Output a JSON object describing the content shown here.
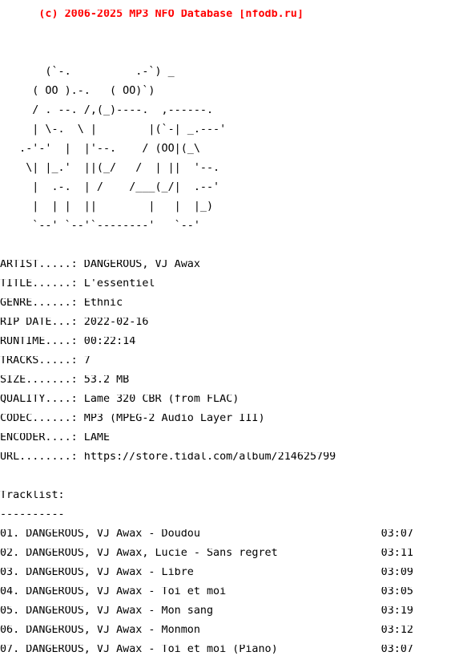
{
  "colors": {
    "background": "#ffffff",
    "text": "#000000",
    "banner": "#ff0000"
  },
  "banner": "      (c) 2006-2025 MP3 NFO Database [nfodb.ru]",
  "logo": [
    "",
    "",
    "       (`-.          .-`) _",
    "     ( OO ).-.   ( OO)`)",
    "     / . --. /,(_)----.  ,------.",
    "     | \\-.  \\ |        |(`-| _.---'",
    "   .-'-'  |  |'--.    / (OO|(_\\",
    "    \\| |_.'  ||(_/   /  | ||  '--.",
    "     |  .-.  | /    /___(_/|  .--'",
    "     |  | |  ||        |   |  |_)",
    "     `--' `--'`--------'   `--'",
    ""
  ],
  "info": [
    "ARTIST.....: DANGEROUS, VJ Awax",
    "TITLE......: L'essentiel",
    "GENRE......: Ethnic",
    "RIP DATE...: 2022-02-16",
    "RUNTIME....: 00:22:14",
    "TRACKS.....: 7",
    "SIZE.......: 53.2 MB",
    "QUALITY....: Lame 320 CBR (from FLAC)",
    "CODEC......: MP3 (MPEG-2 Audio Layer III)",
    "ENCODER....: LAME",
    "URL........: https://store.tidal.com/album/214625799"
  ],
  "tracklist": {
    "heading": "Tracklist:",
    "rule": "----------",
    "tracks": [
      "01. DANGEROUS, VJ Awax - Doudou                            03:07",
      "02. DANGEROUS, VJ Awax, Lucie - Sans regret                03:11",
      "03. DANGEROUS, VJ Awax - Libre                             03:09",
      "04. DANGEROUS, VJ Awax - Toi et moi                        03:05",
      "05. DANGEROUS, VJ Awax - Mon sang                          03:19",
      "06. DANGEROUS, VJ Awax - Monmon                            03:12",
      "07. DANGEROUS, VJ Awax - Toi et moi (Piano)                03:07"
    ]
  }
}
